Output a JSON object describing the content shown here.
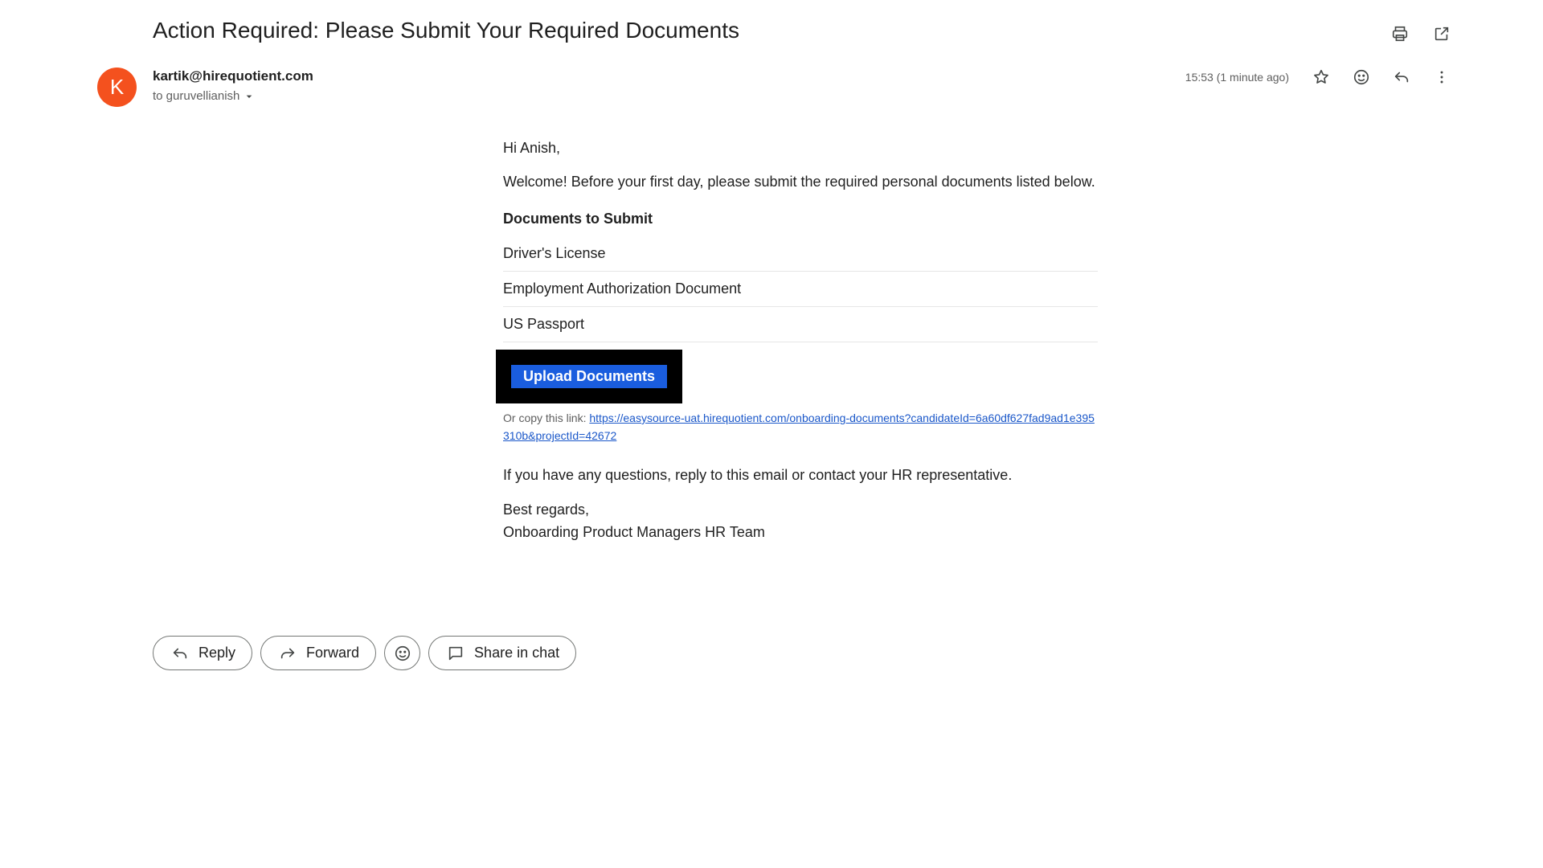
{
  "email": {
    "subject": "Action Required: Please Submit Your Required Documents",
    "sender": {
      "initial": "K",
      "email": "kartik@hirequotient.com",
      "recipient_line": "to guruvellianish",
      "avatar_color": "#f4511e"
    },
    "timestamp": "15:53 (1 minute ago)",
    "body": {
      "greeting": "Hi Anish,",
      "intro": "Welcome! Before your first day, please submit the required personal documents listed below.",
      "docs_heading": "Documents to Submit",
      "documents": [
        "Driver's License",
        "Employment Authorization Document",
        "US Passport"
      ],
      "upload_button": "Upload Documents",
      "copy_link_label": "Or copy this link:",
      "copy_link_url": "https://easysource-uat.hirequotient.com/onboarding-documents?candidateId=6a60df627fad9ad1e395310b&projectId=42672",
      "questions": "If you have any questions, reply to this email or contact your HR representative.",
      "regards": "Best regards,",
      "signature": "Onboarding Product Managers HR Team"
    }
  },
  "actions": {
    "reply": "Reply",
    "forward": "Forward",
    "share_in_chat": "Share in chat"
  },
  "icons": {
    "print": "print-icon",
    "open_new_window": "open-in-new-icon",
    "star": "star-icon",
    "emoji": "emoji-icon",
    "reply": "reply-icon",
    "more": "more-vert-icon",
    "dropdown": "chevron-down-icon",
    "forward": "forward-icon",
    "chat": "chat-bubble-icon"
  },
  "colors": {
    "upload_button_bg": "#1a5dde",
    "link": "#1a57c9"
  }
}
